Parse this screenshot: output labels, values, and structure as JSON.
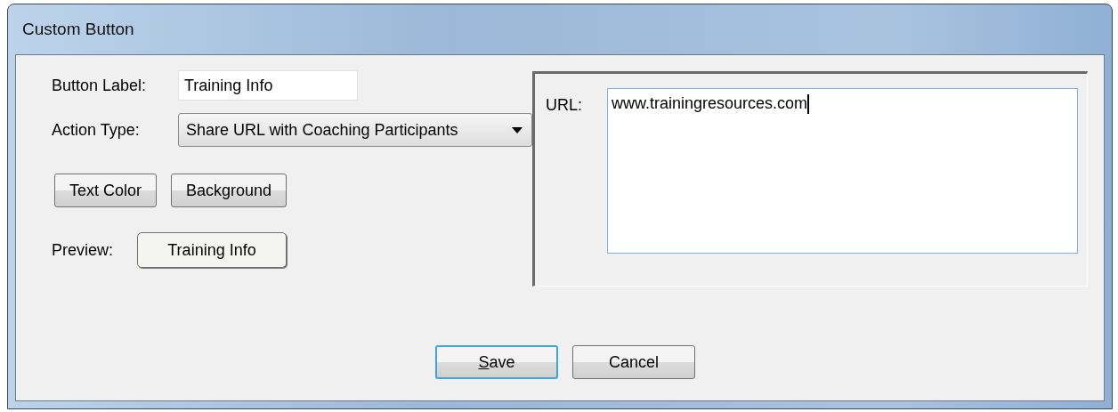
{
  "window": {
    "title": "Custom Button"
  },
  "button_label": {
    "label": "Button Label:",
    "value": "Training Info"
  },
  "action_type": {
    "label": "Action Type:",
    "value": "Share URL with Coaching Participants"
  },
  "color_buttons": [
    "Text Color",
    "Background"
  ],
  "preview": {
    "label": "Preview:",
    "button": "Training Info"
  },
  "url": {
    "label": "URL:",
    "value": "www.trainingresources.com",
    "focused": true
  },
  "buttons": [
    {
      "label": "Save",
      "default": true,
      "underline_first": true
    },
    {
      "label": "Cancel",
      "default": false,
      "underline_first": false
    }
  ]
}
